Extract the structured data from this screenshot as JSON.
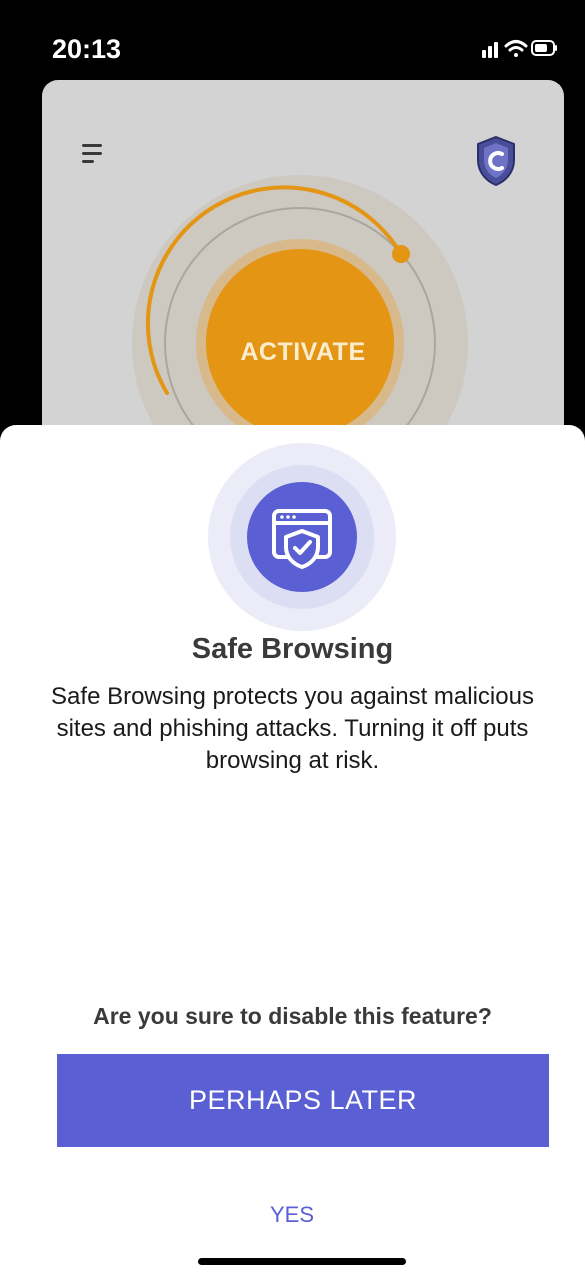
{
  "status_bar": {
    "time": "20:13",
    "icons": [
      "cellular-signal-icon",
      "wifi-icon",
      "battery-icon"
    ]
  },
  "app": {
    "menu_icon": "hamburger-menu-icon",
    "logo_icon": "shield-c-logo-icon",
    "activate_label": "ACTIVATE",
    "dial_color": "#e39513"
  },
  "sheet": {
    "icon": "browser-shield-check-icon",
    "title": "Safe Browsing",
    "description": "Safe Browsing protects you against malicious sites and phishing attacks. Turning it off puts browsing at risk.",
    "question": "Are you sure to disable this feature?",
    "primary_button": "PERHAPS LATER",
    "secondary_button": "YES",
    "accent_color": "#5a5fd4"
  }
}
